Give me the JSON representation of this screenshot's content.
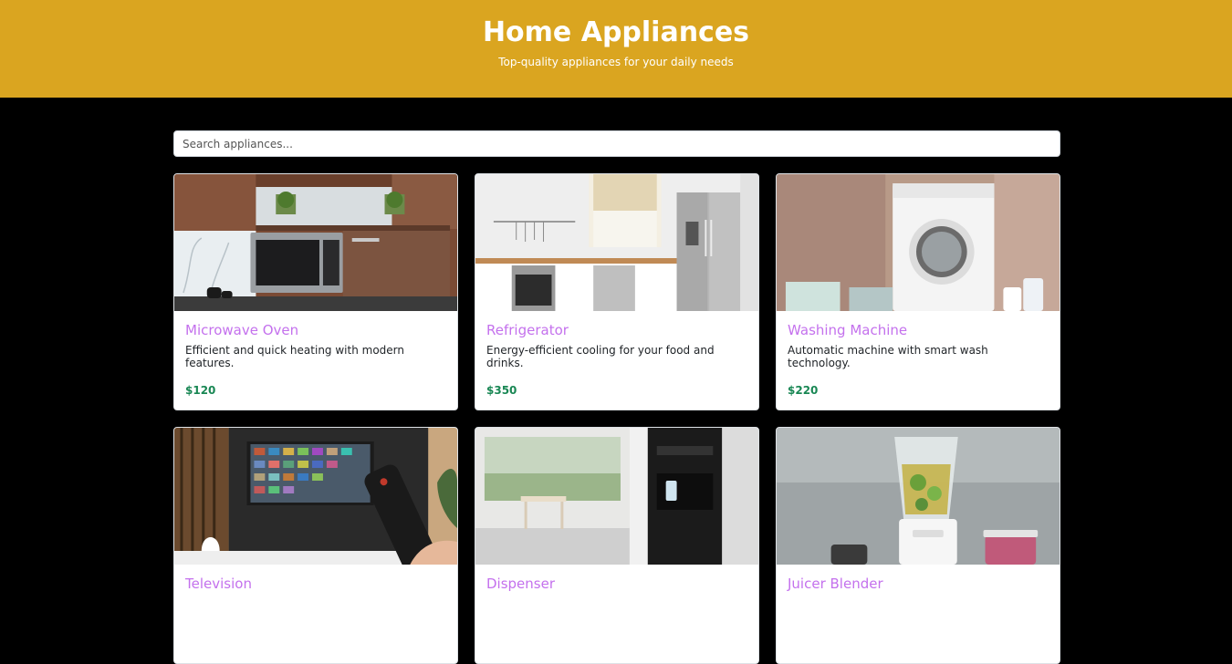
{
  "header": {
    "title": "Home Appliances",
    "subtitle": "Top-quality appliances for your daily needs"
  },
  "search": {
    "placeholder": "Search appliances..."
  },
  "colors": {
    "header_bg": "#daa520",
    "page_bg": "#000000",
    "title_color": "#c471ed",
    "price_color": "#198754"
  },
  "products": [
    {
      "name": "Microwave Oven",
      "description": "Efficient and quick heating with modern features.",
      "price": "$120",
      "icon": "microwave-image"
    },
    {
      "name": "Refrigerator",
      "description": "Energy-efficient cooling for your food and drinks.",
      "price": "$350",
      "icon": "refrigerator-image"
    },
    {
      "name": "Washing Machine",
      "description": "Automatic machine with smart wash technology.",
      "price": "$220",
      "icon": "washing-machine-image"
    },
    {
      "name": "Television",
      "description": "",
      "price": "",
      "icon": "television-image"
    },
    {
      "name": "Dispenser",
      "description": "",
      "price": "",
      "icon": "dispenser-image"
    },
    {
      "name": "Juicer Blender",
      "description": "",
      "price": "",
      "icon": "juicer-blender-image"
    }
  ]
}
